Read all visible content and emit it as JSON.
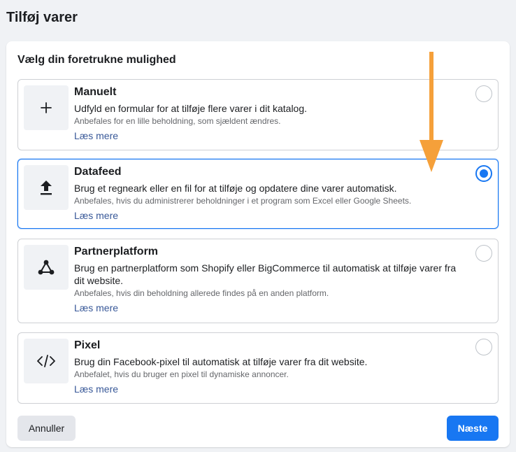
{
  "page": {
    "title": "Tilføj varer"
  },
  "card": {
    "heading": "Vælg din foretrukne mulighed"
  },
  "options": [
    {
      "title": "Manuelt",
      "description": "Udfyld en formular for at tilføje flere varer i dit katalog.",
      "note": "Anbefales for en lille beholdning, som sjældent ændres.",
      "link": "Læs mere",
      "icon": "plus-icon",
      "selected": false
    },
    {
      "title": "Datafeed",
      "description": "Brug et regneark eller en fil for at tilføje og opdatere dine varer automatisk.",
      "note": "Anbefales, hvis du administrerer beholdninger i et program som Excel eller Google Sheets.",
      "link": "Læs mere",
      "icon": "upload-icon",
      "selected": true
    },
    {
      "title": "Partnerplatform",
      "description": "Brug en partnerplatform som Shopify eller BigCommerce til automatisk at tilføje varer fra dit website.",
      "note": "Anbefales, hvis din beholdning allerede findes på en anden platform.",
      "link": "Læs mere",
      "icon": "network-nodes-icon",
      "selected": false
    },
    {
      "title": "Pixel",
      "description": "Brug din Facebook-pixel til automatisk at tilføje varer fra dit website.",
      "note": "Anbefalet, hvis du bruger en pixel til dynamiske annoncer.",
      "link": "Læs mere",
      "icon": "code-icon",
      "selected": false
    }
  ],
  "footer": {
    "cancel_label": "Annuller",
    "next_label": "Næste"
  },
  "colors": {
    "accent": "#1877f2",
    "link": "#385898",
    "annotation_arrow": "#f5a03a",
    "background": "#f0f2f5"
  }
}
